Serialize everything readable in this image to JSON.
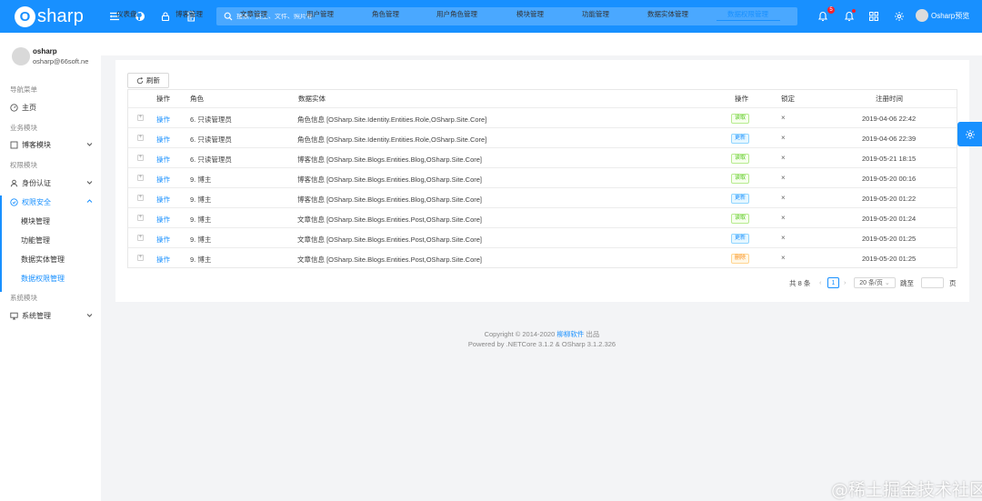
{
  "header": {
    "logo_mark": "O",
    "logo_text": "sharp",
    "search_placeholder": "搜索：员工、文件、照片等",
    "notification_count": "5",
    "user_name": "Osharp预览",
    "icons": [
      "menu-icon",
      "github-icon",
      "lock-icon",
      "document-icon",
      "search-icon",
      "bell-icon",
      "alert-bell-icon",
      "grid-icon",
      "gear-icon"
    ]
  },
  "sidebar": {
    "profile": {
      "name": "osharp",
      "email": "osharp@66soft.ne"
    },
    "nav_label": "导航菜单",
    "home": "主页",
    "group_business": "业务模块",
    "blog_manage": "博客模块",
    "group_permission": "权限模块",
    "identity": "身份认证",
    "security": "权限安全",
    "sub_items": [
      "模块管理",
      "功能管理",
      "数据实体管理",
      "数据权限管理"
    ],
    "group_system": "系统模块",
    "system_manage": "系统管理"
  },
  "tabs": [
    "仪表盘",
    "博客管理",
    "文章管理",
    "用户管理",
    "角色管理",
    "用户角色管理",
    "模块管理",
    "功能管理",
    "数据实体管理",
    "数据权限管理"
  ],
  "active_tab": "数据权限管理",
  "toolbar": {
    "refresh": "刷新"
  },
  "table": {
    "headers": [
      "操作",
      "角色",
      "数据实体",
      "操作",
      "锁定",
      "注册时间"
    ],
    "rows": [
      {
        "action": "操作",
        "role": "6. 只读管理员",
        "entity": "角色信息 [OSharp.Site.Identity.Entities.Role,OSharp.Site.Core]",
        "op": "读取",
        "op_color": "green",
        "locked": "×",
        "time": "2019-04-06 22:42"
      },
      {
        "action": "操作",
        "role": "6. 只读管理员",
        "entity": "角色信息 [OSharp.Site.Identity.Entities.Role,OSharp.Site.Core]",
        "op": "更新",
        "op_color": "blue",
        "locked": "×",
        "time": "2019-04-06 22:39"
      },
      {
        "action": "操作",
        "role": "6. 只读管理员",
        "entity": "博客信息 [OSharp.Site.Blogs.Entities.Blog,OSharp.Site.Core]",
        "op": "读取",
        "op_color": "green",
        "locked": "×",
        "time": "2019-05-21 18:15"
      },
      {
        "action": "操作",
        "role": "9. 博主",
        "entity": "博客信息 [OSharp.Site.Blogs.Entities.Blog,OSharp.Site.Core]",
        "op": "读取",
        "op_color": "green",
        "locked": "×",
        "time": "2019-05-20 00:16"
      },
      {
        "action": "操作",
        "role": "9. 博主",
        "entity": "博客信息 [OSharp.Site.Blogs.Entities.Blog,OSharp.Site.Core]",
        "op": "更新",
        "op_color": "blue",
        "locked": "×",
        "time": "2019-05-20 01:22"
      },
      {
        "action": "操作",
        "role": "9. 博主",
        "entity": "文章信息 [OSharp.Site.Blogs.Entities.Post,OSharp.Site.Core]",
        "op": "读取",
        "op_color": "green",
        "locked": "×",
        "time": "2019-05-20 01:24"
      },
      {
        "action": "操作",
        "role": "9. 博主",
        "entity": "文章信息 [OSharp.Site.Blogs.Entities.Post,OSharp.Site.Core]",
        "op": "更新",
        "op_color": "blue",
        "locked": "×",
        "time": "2019-05-20 01:25"
      },
      {
        "action": "操作",
        "role": "9. 博主",
        "entity": "文章信息 [OSharp.Site.Blogs.Entities.Post,OSharp.Site.Core]",
        "op": "删除",
        "op_color": "orange",
        "locked": "×",
        "time": "2019-05-20 01:25"
      }
    ]
  },
  "pagination": {
    "total": "共 8 条",
    "current_page": "1",
    "page_size": "20 条/页",
    "goto_label": "跳至",
    "page_suffix": "页"
  },
  "footer": {
    "copyright_prefix": "Copyright © 2014-2020 ",
    "company": "柳柳软件",
    "copyright_suffix": " 出品",
    "powered": "Powered by .NETCore 3.1.2 & OSharp 3.1.2.326"
  },
  "watermark": "@稀土掘金技术社区",
  "colors": {
    "primary": "#1890ff",
    "background": "#f3f4f6",
    "danger": "#f5222d"
  }
}
